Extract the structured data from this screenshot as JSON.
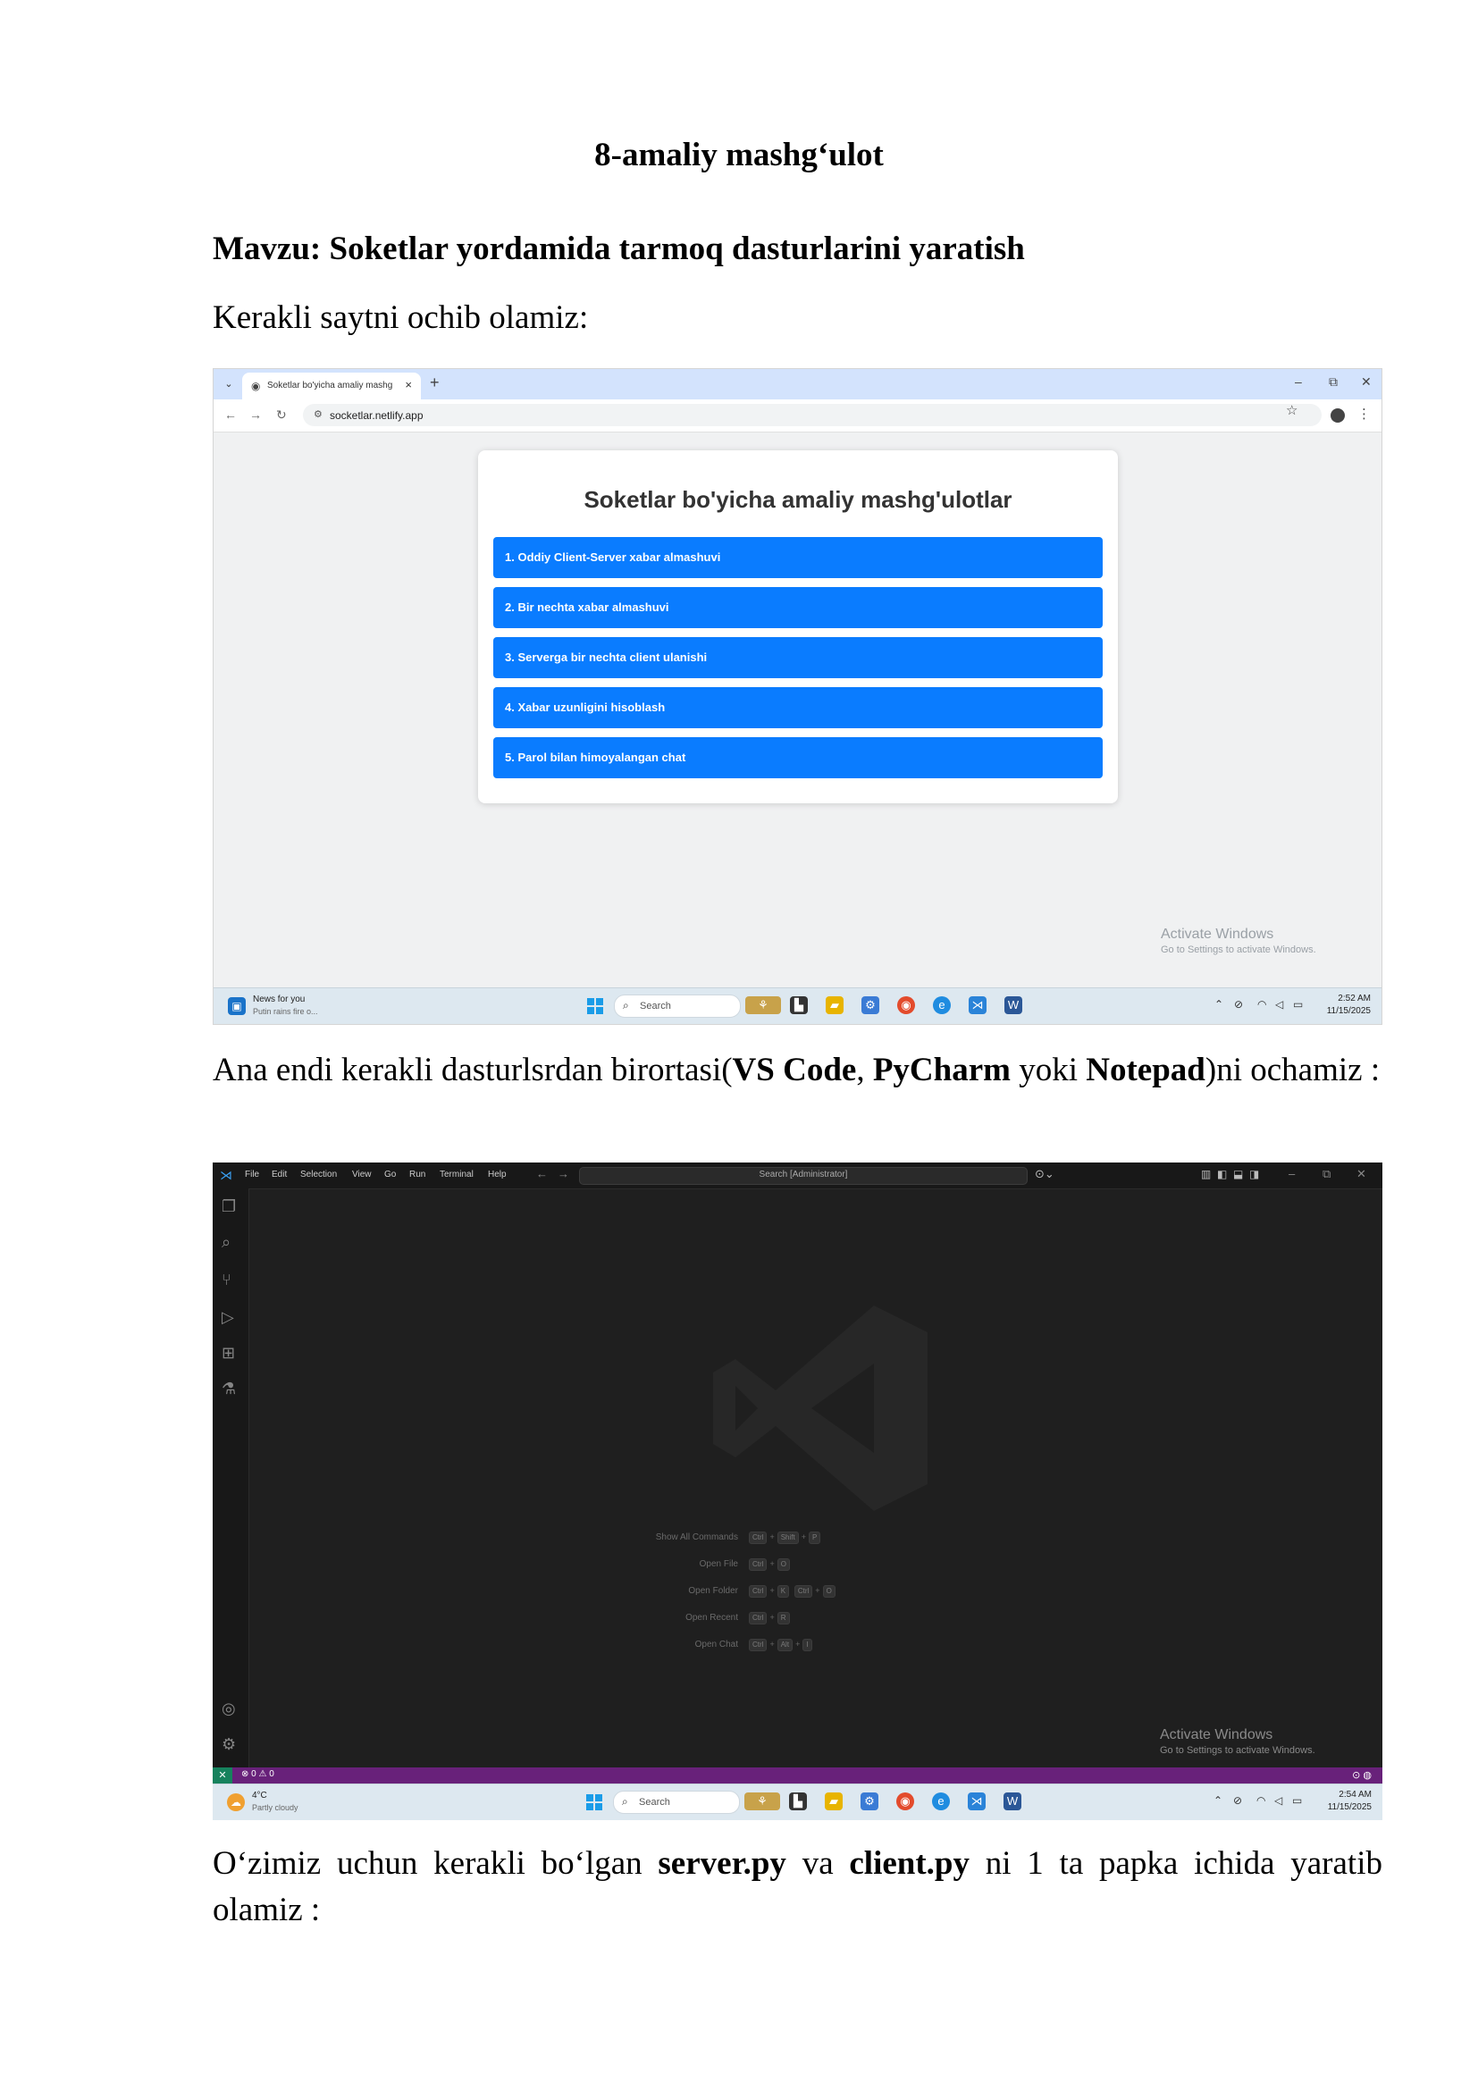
{
  "doc": {
    "title": "8-amaliy mashg‘ulot",
    "topic": "Mavzu: Soketlar yordamida tarmoq dasturlarini yaratish",
    "para1": "Kerakli saytni ochib olamiz:",
    "para2": {
      "t1": "Ana endi kerakli dasturlsrdan birortasi(",
      "b1": "VS Code",
      "t2": ", ",
      "b2": "PyCharm",
      "t3": " yoki ",
      "b3": "Notepad",
      "t4": ")ni ochamiz :"
    },
    "para3": {
      "t1": "O‘zimiz uchun kerakli bo‘lgan ",
      "b1": "server.py",
      "t2": " va ",
      "b2": "client.py",
      "t3": " ni 1 ta papka ichida yaratib olamiz :"
    }
  },
  "browser": {
    "tab_title": "Soketlar bo'yicha amaliy mashg",
    "url": "socketlar.netlify.app",
    "page_title": "Soketlar bo'yicha amaliy mashg'ulotlar",
    "buttons": [
      "1. Oddiy Client-Server xabar almashuvi",
      "2. Bir nechta xabar almashuvi",
      "3. Serverga bir nechta client ulanishi",
      "4. Xabar uzunligini hisoblash",
      "5. Parol bilan himoyalangan chat"
    ],
    "activate_title": "Activate Windows",
    "activate_sub": "Go to Settings to activate Windows.",
    "taskbar": {
      "news_title": "News for you",
      "news_sub": "Putin rains fire o...",
      "search": "Search",
      "time": "2:52 AM",
      "date": "11/15/2025"
    }
  },
  "vscode": {
    "menu": [
      "File",
      "Edit",
      "Selection",
      "View",
      "Go",
      "Run",
      "Terminal",
      "Help"
    ],
    "search": "Search [Administrator]",
    "shortcuts": [
      {
        "label": "Show All Commands",
        "keys": [
          [
            "Ctrl",
            "Shift",
            "P"
          ]
        ]
      },
      {
        "label": "Open File",
        "keys": [
          [
            "Ctrl",
            "O"
          ]
        ]
      },
      {
        "label": "Open Folder",
        "keys": [
          [
            "Ctrl",
            "K"
          ],
          [
            "Ctrl",
            "O"
          ]
        ]
      },
      {
        "label": "Open Recent",
        "keys": [
          [
            "Ctrl",
            "R"
          ]
        ]
      },
      {
        "label": "Open Chat",
        "keys": [
          [
            "Ctrl",
            "Alt",
            "I"
          ]
        ]
      }
    ],
    "status_problems": "⊗ 0 ⚠ 0",
    "activate_title": "Activate Windows",
    "activate_sub": "Go to Settings to activate Windows.",
    "taskbar": {
      "weather_temp": "4°C",
      "weather_desc": "Partly cloudy",
      "search": "Search",
      "time": "2:54 AM",
      "date": "11/15/2025"
    }
  },
  "colors": {
    "button_blue": "#0a7cff",
    "vscode_status": "#68217a",
    "vscode_bg": "#1f1f1f"
  }
}
